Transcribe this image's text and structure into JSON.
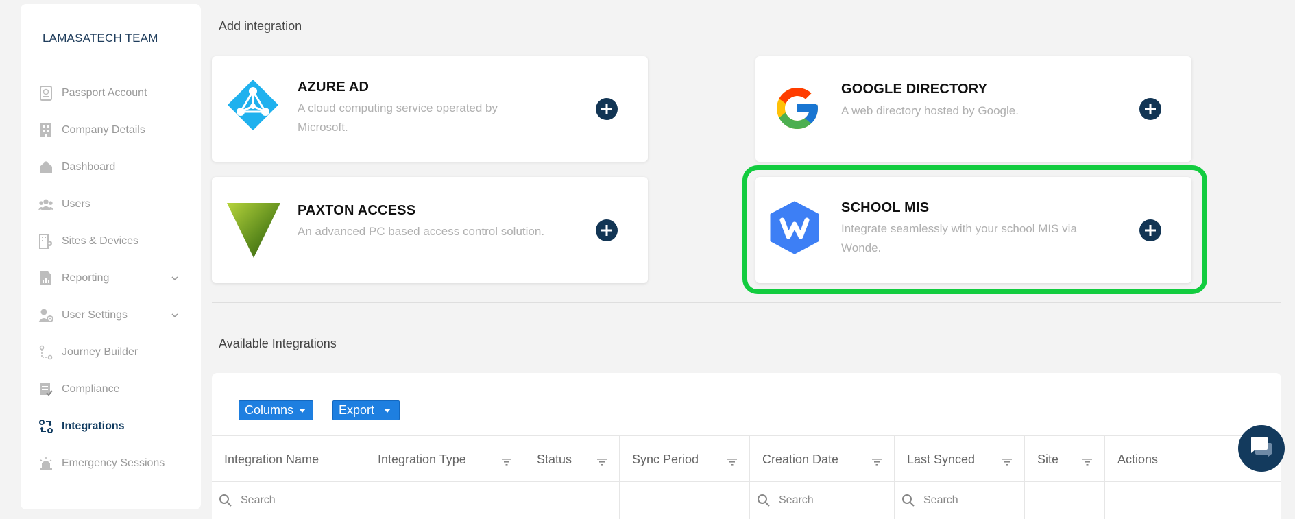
{
  "sidebar": {
    "team": "LAMASATECH TEAM",
    "items": [
      {
        "label": "Passport Account",
        "icon": "passport-icon"
      },
      {
        "label": "Company Details",
        "icon": "building-icon"
      },
      {
        "label": "Dashboard",
        "icon": "home-icon"
      },
      {
        "label": "Users",
        "icon": "users-icon"
      },
      {
        "label": "Sites & Devices",
        "icon": "sites-icon"
      },
      {
        "label": "Reporting",
        "icon": "report-icon"
      },
      {
        "label": "User Settings",
        "icon": "user-settings-icon"
      },
      {
        "label": "Journey Builder",
        "icon": "journey-icon"
      },
      {
        "label": "Compliance",
        "icon": "compliance-icon"
      },
      {
        "label": "Integrations",
        "icon": "integrations-icon"
      },
      {
        "label": "Emergency Sessions",
        "icon": "alarm-icon"
      }
    ]
  },
  "add_integration": {
    "title": "Add integration",
    "cards": {
      "azure": {
        "title": "AZURE AD",
        "desc1": "A cloud computing service operated by",
        "desc2": "Microsoft."
      },
      "google": {
        "title": "GOOGLE DIRECTORY",
        "desc1": "A web directory hosted by Google."
      },
      "paxton": {
        "title": "PAXTON ACCESS",
        "desc1": "An advanced PC based access control solution."
      },
      "school": {
        "title": "SCHOOL MIS",
        "desc1": "Integrate seamlessly with your school MIS via",
        "desc2": "Wonde."
      }
    }
  },
  "available": {
    "title": "Available Integrations",
    "columns_btn": "Columns",
    "export_btn": "Export",
    "headers": [
      "Integration Name",
      "Integration Type",
      "Status",
      "Sync Period",
      "Creation Date",
      "Last Synced",
      "Site",
      "Actions"
    ],
    "search_placeholder": "Search"
  },
  "colors": {
    "accent": "#1e7fe0",
    "navy": "#123554",
    "highlight": "#12cc3f"
  }
}
